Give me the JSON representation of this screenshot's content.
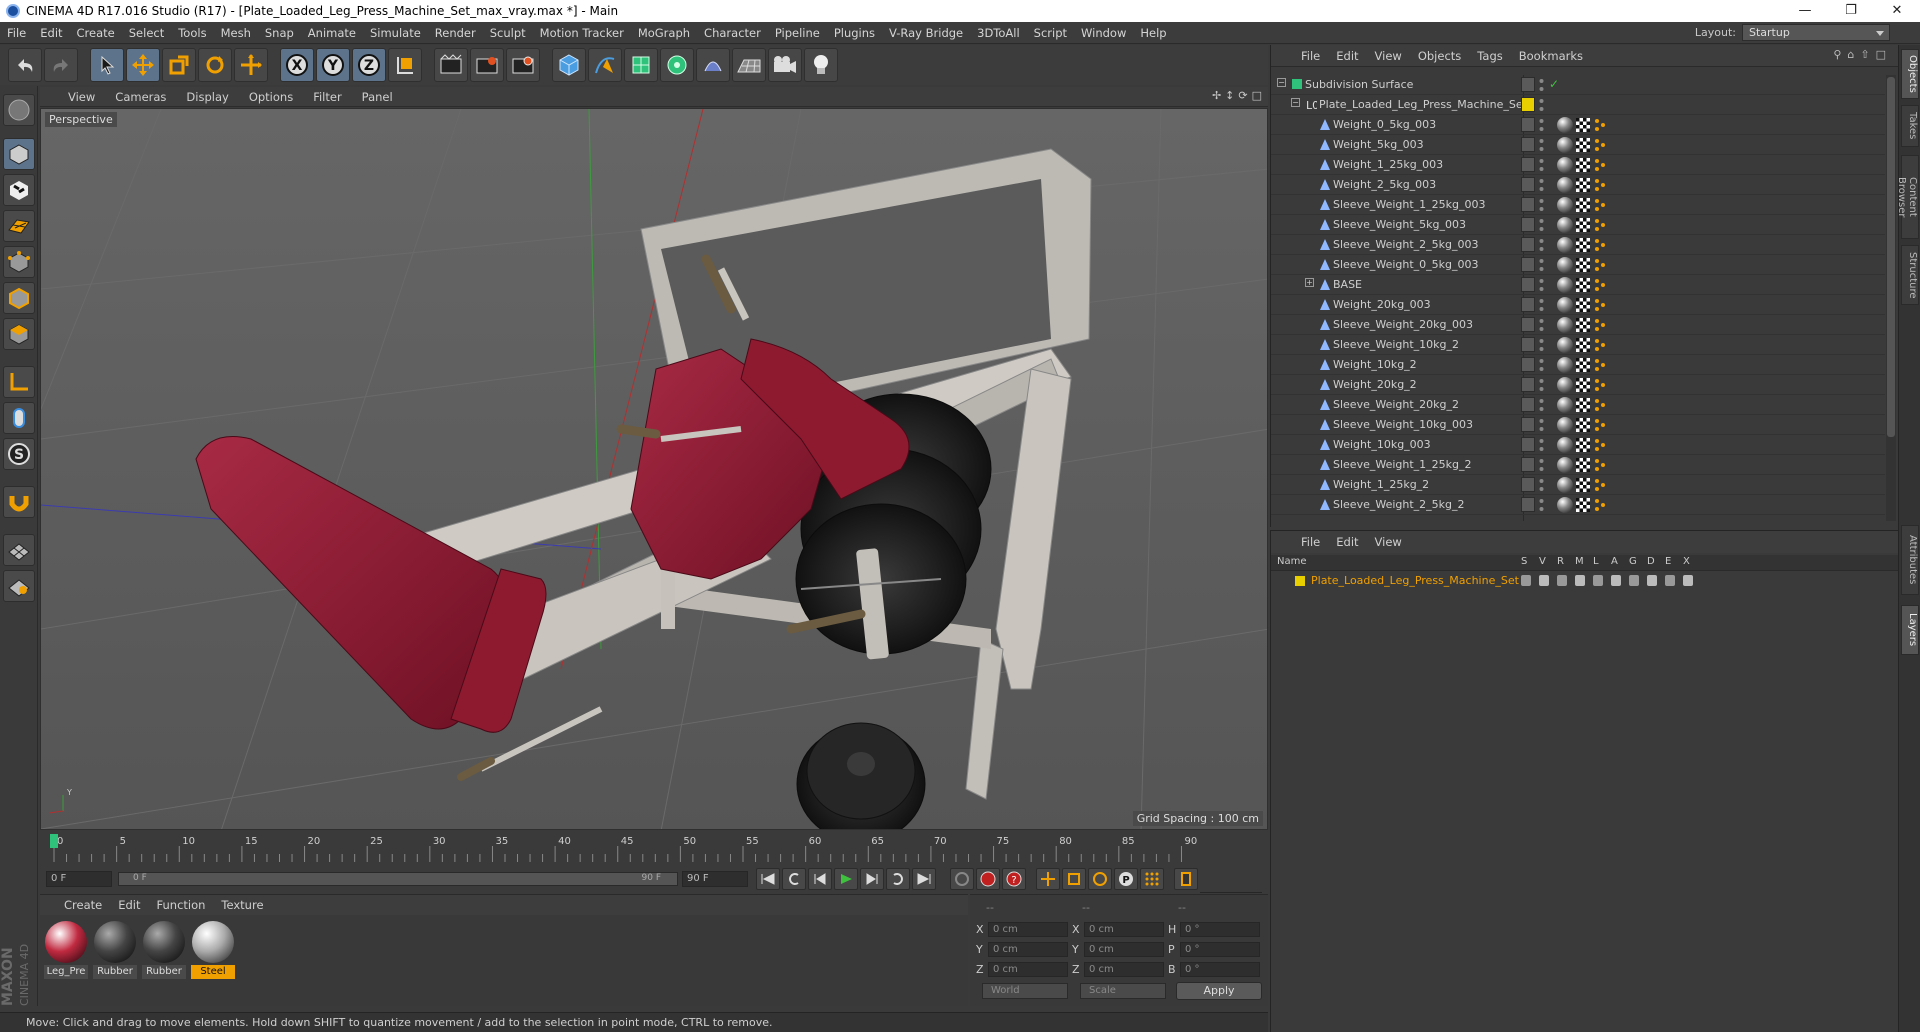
{
  "window": {
    "title": "CINEMA 4D R17.016 Studio (R17) - [Plate_Loaded_Leg_Press_Machine_Set_max_vray.max *] - Main"
  },
  "menu": [
    "File",
    "Edit",
    "Create",
    "Select",
    "Tools",
    "Mesh",
    "Snap",
    "Animate",
    "Simulate",
    "Render",
    "Sculpt",
    "Motion Tracker",
    "MoGraph",
    "Character",
    "Pipeline",
    "Plugins",
    "V-Ray Bridge",
    "3DToAll",
    "Script",
    "Window",
    "Help"
  ],
  "layout": {
    "label": "Layout:",
    "value": "Startup"
  },
  "viewport": {
    "menu": [
      "View",
      "Cameras",
      "Display",
      "Options",
      "Filter",
      "Panel"
    ],
    "camera_label": "Perspective",
    "grid_spacing": "Grid Spacing : 100 cm"
  },
  "timeline": {
    "ticks": [
      "0",
      "5",
      "10",
      "15",
      "20",
      "25",
      "30",
      "35",
      "40",
      "45",
      "50",
      "55",
      "60",
      "65",
      "70",
      "75",
      "80",
      "85",
      "90"
    ],
    "current_frame": "0 F",
    "start_field": "0 F",
    "range_start": "0 F",
    "range_end": "90 F",
    "end_field": "90 F"
  },
  "materials": {
    "menu": [
      "Create",
      "Edit",
      "Function",
      "Texture"
    ],
    "items": [
      {
        "label": "Leg_Pre",
        "selected": false
      },
      {
        "label": "Rubber",
        "selected": false
      },
      {
        "label": "Rubber",
        "selected": false
      },
      {
        "label": "Steel",
        "selected": true
      }
    ]
  },
  "coords": {
    "header": [
      "--",
      "--",
      "--"
    ],
    "rows": [
      {
        "a": "X",
        "av": "0 cm",
        "b": "X",
        "bv": "0 cm",
        "c": "H",
        "cv": "0 °"
      },
      {
        "a": "Y",
        "av": "0 cm",
        "b": "Y",
        "bv": "0 cm",
        "c": "P",
        "cv": "0 °"
      },
      {
        "a": "Z",
        "av": "0 cm",
        "b": "Z",
        "bv": "0 cm",
        "c": "B",
        "cv": "0 °"
      }
    ],
    "mode1": "World",
    "mode2": "Scale",
    "apply": "Apply"
  },
  "status": "Move: Click and drag to move elements. Hold down SHIFT to quantize movement / add to the selection in point mode, CTRL to remove.",
  "objects": {
    "menu": [
      "File",
      "Edit",
      "View",
      "Objects",
      "Tags",
      "Bookmarks"
    ],
    "items": [
      {
        "name": "Subdivision Surface",
        "level": 0,
        "type": "subdiv"
      },
      {
        "name": "Plate_Loaded_Leg_Press_Machine_Set",
        "level": 1,
        "type": "null"
      },
      {
        "name": "Weight_0_5kg_003",
        "level": 2,
        "type": "poly"
      },
      {
        "name": "Weight_5kg_003",
        "level": 2,
        "type": "poly"
      },
      {
        "name": "Weight_1_25kg_003",
        "level": 2,
        "type": "poly"
      },
      {
        "name": "Weight_2_5kg_003",
        "level": 2,
        "type": "poly"
      },
      {
        "name": "Sleeve_Weight_1_25kg_003",
        "level": 2,
        "type": "poly"
      },
      {
        "name": "Sleeve_Weight_5kg_003",
        "level": 2,
        "type": "poly"
      },
      {
        "name": "Sleeve_Weight_2_5kg_003",
        "level": 2,
        "type": "poly"
      },
      {
        "name": "Sleeve_Weight_0_5kg_003",
        "level": 2,
        "type": "poly"
      },
      {
        "name": "BASE",
        "level": 2,
        "type": "group"
      },
      {
        "name": "Weight_20kg_003",
        "level": 2,
        "type": "poly"
      },
      {
        "name": "Sleeve_Weight_20kg_003",
        "level": 2,
        "type": "poly"
      },
      {
        "name": "Sleeve_Weight_10kg_2",
        "level": 2,
        "type": "poly"
      },
      {
        "name": "Weight_10kg_2",
        "level": 2,
        "type": "poly"
      },
      {
        "name": "Weight_20kg_2",
        "level": 2,
        "type": "poly"
      },
      {
        "name": "Sleeve_Weight_20kg_2",
        "level": 2,
        "type": "poly"
      },
      {
        "name": "Sleeve_Weight_10kg_003",
        "level": 2,
        "type": "poly"
      },
      {
        "name": "Weight_10kg_003",
        "level": 2,
        "type": "poly"
      },
      {
        "name": "Sleeve_Weight_1_25kg_2",
        "level": 2,
        "type": "poly"
      },
      {
        "name": "Weight_1_25kg_2",
        "level": 2,
        "type": "poly"
      },
      {
        "name": "Sleeve_Weight_2_5kg_2",
        "level": 2,
        "type": "poly"
      }
    ]
  },
  "layers": {
    "menu": [
      "File",
      "Edit",
      "View"
    ],
    "columns": [
      "Name",
      "S",
      "V",
      "R",
      "M",
      "L",
      "A",
      "G",
      "D",
      "E",
      "X"
    ],
    "items": [
      {
        "name": "Plate_Loaded_Leg_Press_Machine_Set",
        "color": "#e8d000"
      }
    ]
  },
  "side_tabs": [
    "Objects",
    "Takes",
    "Content Browser",
    "Structure",
    "Attributes",
    "Layers"
  ],
  "brand": {
    "maxon": "MAXON",
    "product": "CINEMA 4D"
  },
  "colors": {
    "accent": "#f0a000",
    "selection_blue": "#5d738c",
    "seat_red": "#8e1a30",
    "floor": "#5b5b5b"
  }
}
